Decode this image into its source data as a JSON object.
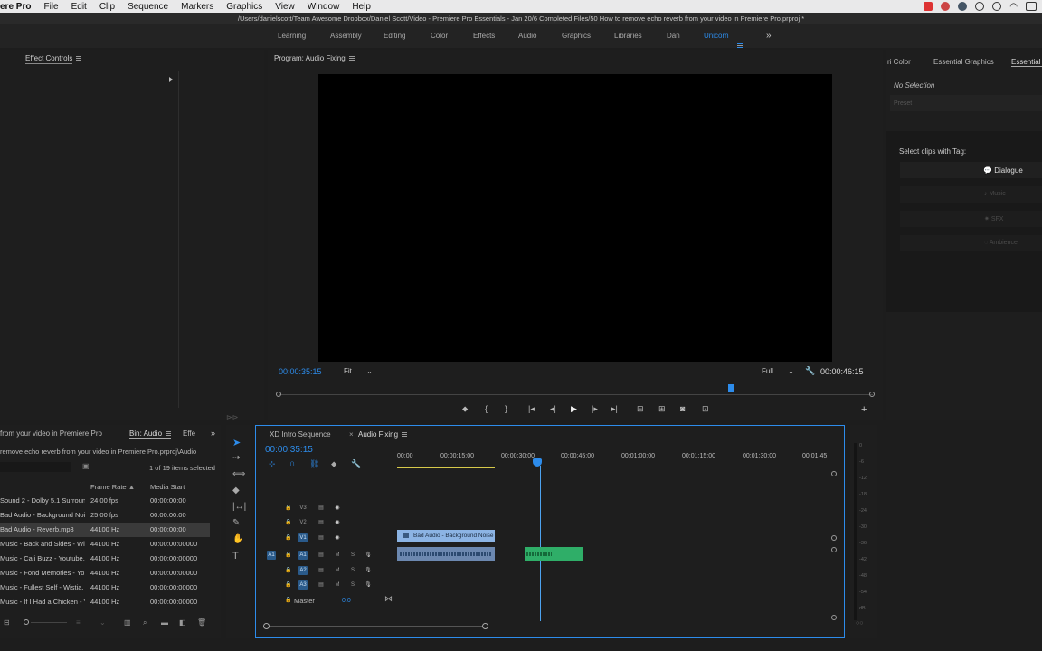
{
  "menubar": {
    "app": "ere Pro",
    "items": [
      "File",
      "Edit",
      "Clip",
      "Sequence",
      "Markers",
      "Graphics",
      "View",
      "Window",
      "Help"
    ]
  },
  "titlebar": "/Users/danielscott/Team Awesome Dropbox/Daniel Scott/Video - Premiere Pro Essentials - Jan 20/6 Completed Files/50 How to remove echo reverb from your video in Premiere Pro.prproj *",
  "workspaces": {
    "items": [
      "Learning",
      "Assembly",
      "Editing",
      "Color",
      "Effects",
      "Audio",
      "Graphics",
      "Libraries",
      "Dan",
      "Unicorn"
    ],
    "active": "Unicorn",
    "more": "»"
  },
  "effect_controls": {
    "title": "Effect Controls"
  },
  "program": {
    "title": "Program: Audio Fixing",
    "timecode": "00:00:35:15",
    "fit": "Fit",
    "quality": "Full",
    "duration": "00:00:46:15"
  },
  "essential_panel": {
    "tabs": [
      "ri Color",
      "Essential Graphics",
      "Essential S"
    ],
    "no_selection": "No Selection",
    "preset": "Preset",
    "select_tag": "Select clips with Tag:",
    "tags": [
      "Dialogue",
      "Music",
      "SFX",
      "Ambience"
    ]
  },
  "project": {
    "path_title": "from your video in Premiere Pro",
    "bin_tab": "Bin: Audio",
    "effects_tab": "Effe",
    "path": "remove echo reverb from your video in Premiere Pro.prproj\\Audio",
    "selected": "1 of 19 items selected",
    "columns": {
      "frame_rate": "Frame Rate",
      "media_start": "Media Start"
    },
    "rows": [
      {
        "name": "Sound 2 - Dolby 5.1 Surroun",
        "rate": "24.00 fps",
        "start": "00:00:00:00"
      },
      {
        "name": "Bad Audio - Background Noi",
        "rate": "25.00 fps",
        "start": "00:00:00:00"
      },
      {
        "name": "Bad Audio - Reverb.mp3",
        "rate": "44100 Hz",
        "start": "00:00:00:00"
      },
      {
        "name": "Music - Back and Sides - Wis",
        "rate": "44100 Hz",
        "start": "00:00:00:00000"
      },
      {
        "name": "Music - Cali Buzz - Youtube.",
        "rate": "44100 Hz",
        "start": "00:00:00:00000"
      },
      {
        "name": "Music - Fond Memories - Yo",
        "rate": "44100 Hz",
        "start": "00:00:00:00000"
      },
      {
        "name": "Music - Fullest Self - Wistia.",
        "rate": "44100 Hz",
        "start": "00:00:00:00000"
      },
      {
        "name": "Music - If I Had a Chicken - Y",
        "rate": "44100 Hz",
        "start": "00:00:00:00000"
      }
    ]
  },
  "timeline": {
    "tabs": [
      "XD Intro Sequence",
      "Audio Fixing"
    ],
    "timecode": "00:00:35:15",
    "ruler": [
      "00:00",
      "00:00:15:00",
      "00:00:30:00",
      "00:00:45:00",
      "00:01:00:00",
      "00:01:15:00",
      "00:01:30:00",
      "00:01:45"
    ],
    "tracks": {
      "video": [
        "V3",
        "V2",
        "V1"
      ],
      "audio": [
        "A1",
        "A2",
        "A3"
      ],
      "master": "Master",
      "master_value": "0.0",
      "a1_source": "A1",
      "v1_source": "V1"
    },
    "clip_title": "Bad Audio - Background Noise",
    "ms": {
      "m": "M",
      "s": "S"
    }
  },
  "meter": {
    "scale": [
      "0",
      "-6",
      "-12",
      "-18",
      "-24",
      "-30",
      "-36",
      "-42",
      "-48",
      "-54",
      "dB"
    ]
  },
  "colors": {
    "accent": "#2d8ceb",
    "panel": "#1e1e1e",
    "clip_blue": "#8cb4e4",
    "clip_green": "#2fae68"
  }
}
